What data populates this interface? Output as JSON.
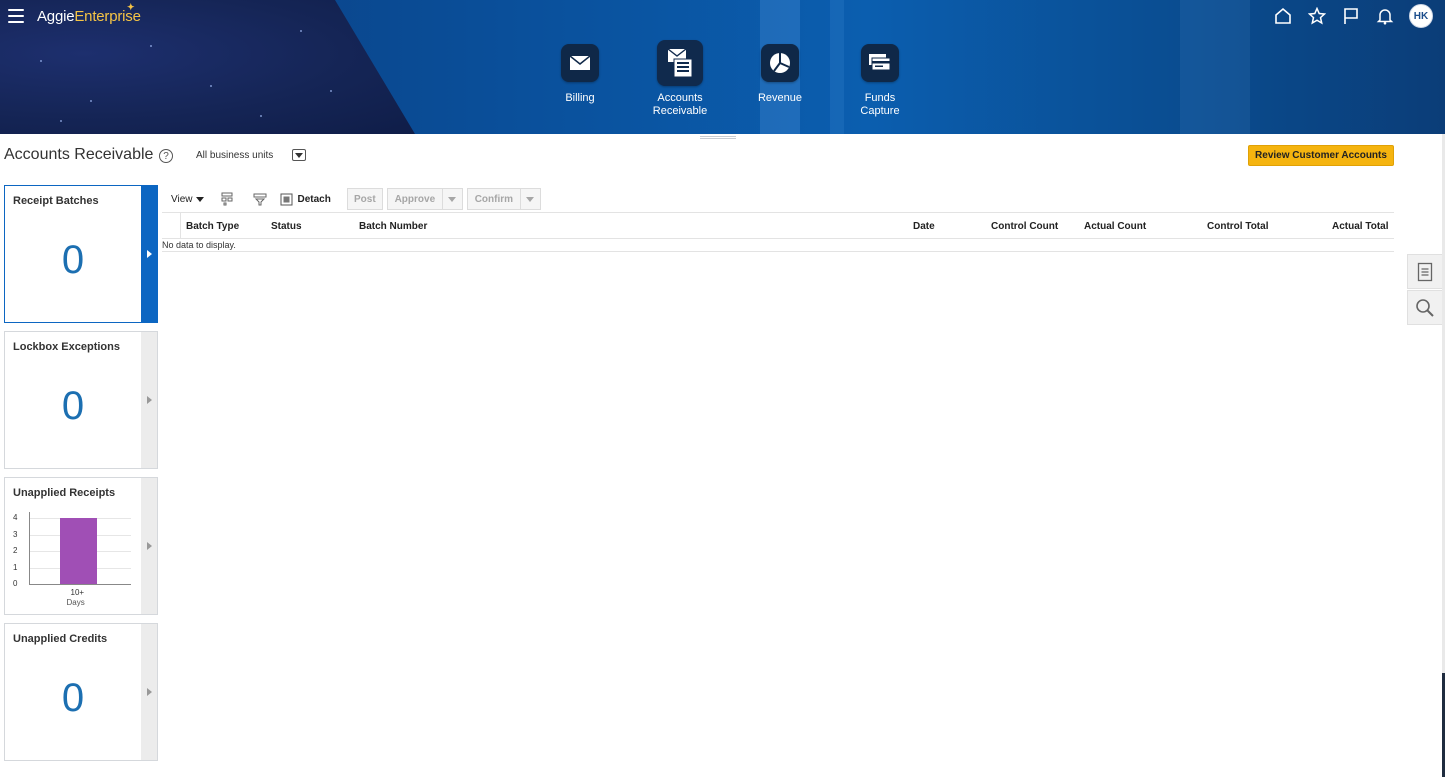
{
  "brand": {
    "name_part1": "Aggie",
    "name_part2": "Enterprise"
  },
  "global_icons": [
    "home-icon",
    "favorites-star-icon",
    "watchlist-flag-icon",
    "notifications-bell-icon"
  ],
  "user": {
    "initials": "HK"
  },
  "springboard": [
    {
      "label": "Billing",
      "icon": "envelope-icon"
    },
    {
      "label": "Accounts Receivable",
      "icon": "invoice-icon"
    },
    {
      "label": "Revenue",
      "icon": "pie-chart-icon"
    },
    {
      "label": "Funds Capture",
      "icon": "cards-icon"
    }
  ],
  "page": {
    "title": "Accounts Receivable",
    "business_unit": "All business units",
    "review_button": "Review Customer Accounts"
  },
  "infolets": {
    "receipt_batches": {
      "title": "Receipt Batches",
      "value": "0"
    },
    "lockbox_exceptions": {
      "title": "Lockbox Exceptions",
      "value": "0"
    },
    "unapplied_receipts": {
      "title": "Unapplied Receipts"
    },
    "unapplied_credits": {
      "title": "Unapplied Credits",
      "value": "0"
    }
  },
  "chart_data": {
    "type": "bar",
    "title": "Unapplied Receipts",
    "categories": [
      "10+"
    ],
    "values": [
      4
    ],
    "xlabel": "Days",
    "ylabel": "",
    "yticks": [
      "0",
      "1",
      "2",
      "3",
      "4"
    ],
    "ylim": [
      0,
      4
    ],
    "color": "#a04fb5",
    "grid": true
  },
  "toolbar": {
    "view": "View",
    "detach": "Detach",
    "post": "Post",
    "approve": "Approve",
    "confirm": "Confirm"
  },
  "table": {
    "columns": [
      "Batch Type",
      "Status",
      "Batch Number",
      "Date",
      "Control Count",
      "Actual Count",
      "Control Total",
      "Actual Total"
    ],
    "empty_message": "No data to display."
  }
}
